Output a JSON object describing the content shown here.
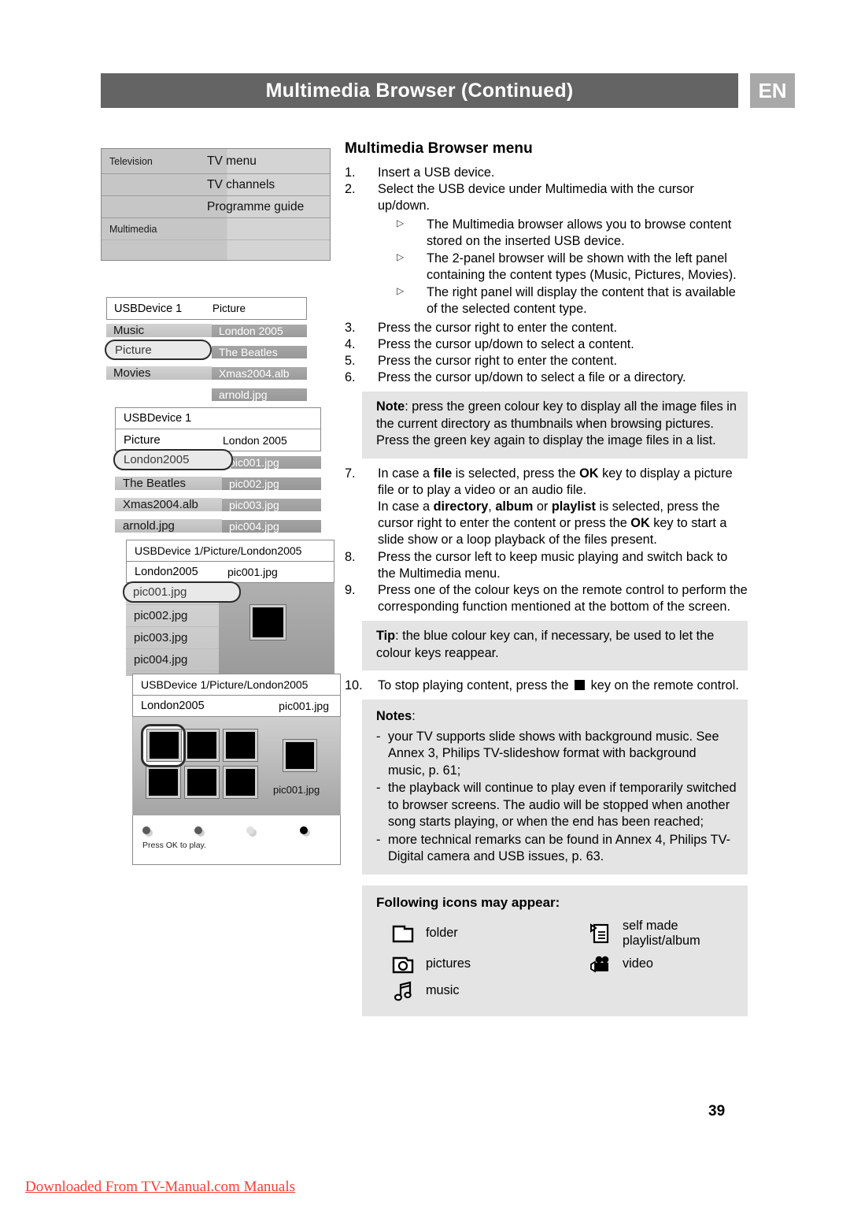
{
  "header": {
    "title": "Multimedia Browser  (Continued)",
    "language_badge": "EN",
    "bar_color": "#646464",
    "badge_color": "#a8a8a8"
  },
  "illustrations": {
    "tv_menu_panel": {
      "left_items": [
        "Television",
        "Multimedia"
      ],
      "right_items": [
        "TV menu",
        "TV channels",
        "Programme guide"
      ]
    },
    "usb_browser_panel": {
      "header_left": "USBDevice 1",
      "header_right": "Picture",
      "left_items": [
        "Music",
        "Picture",
        "Movies"
      ],
      "right_items": [
        "London 2005",
        "The Beatles",
        "Xmas2004.alb",
        "arnold.jpg"
      ],
      "selected": "Picture"
    },
    "usb_picture_panel": {
      "title": "USBDevice 1",
      "col_header_left": "Picture",
      "col_header_right": "London 2005",
      "left_items": [
        "London2005",
        "The Beatles",
        "Xmas2004.alb",
        "arnold.jpg"
      ],
      "right_items": [
        "pic001.jpg",
        "pic002.jpg",
        "pic003.jpg",
        "pic004.jpg"
      ],
      "selected": "London2005"
    },
    "usb_list_panel": {
      "path": "USBDevice 1/Picture/London2005",
      "col_header_left": "London2005",
      "col_header_right": "pic001.jpg",
      "items": [
        "pic001.jpg",
        "pic002.jpg",
        "pic003.jpg",
        "pic004.jpg"
      ],
      "selected": "pic001.jpg"
    },
    "usb_thumbnail_panel": {
      "path": "USBDevice 1/Picture/London2005",
      "col_header_left": "London2005",
      "col_header_right": "pic001.jpg",
      "preview_caption": "pic001.jpg",
      "thumbnail_count": 6,
      "status_text": "Press OK to play.",
      "colour_keys": [
        "#5a5a5a",
        "#5a5a5a",
        "#e0e0e0",
        "#000000"
      ]
    }
  },
  "main": {
    "section_title": "Multimedia Browser menu",
    "steps": [
      {
        "num": "1.",
        "text": "Insert a USB device.",
        "subs": []
      },
      {
        "num": "2.",
        "text": "Select the USB device under Multimedia with the cursor up/down.",
        "subs": [
          "The Multimedia browser allows you to browse content stored on the inserted USB device.",
          "The 2-panel browser will be shown with the left panel containing the content types (Music, Pictures, Movies).",
          "The right panel will display the content that is available of the selected content type."
        ]
      },
      {
        "num": "3.",
        "text": "Press the cursor right to enter the content.",
        "subs": []
      },
      {
        "num": "4.",
        "text": "Press the cursor up/down to select a content.",
        "subs": []
      },
      {
        "num": "5.",
        "text": "Press the cursor right to enter the content.",
        "subs": []
      },
      {
        "num": "6.",
        "text": "Press the cursor up/down to select a file or a directory.",
        "subs": []
      }
    ],
    "note_callout": {
      "label": "Note",
      "text": ": press the green colour key to display all the image files in the current directory as thumbnails when browsing pictures. Press the green key again to display the image files in a list."
    },
    "step7": {
      "num": "7.",
      "line1_a": "In case a ",
      "line1_b": "file",
      "line1_c": " is selected, press the ",
      "line1_d": "OK",
      "line1_e": " key to display a picture file or to play a video or an audio file.",
      "line2_a": "In case a ",
      "line2_b": "directory",
      "line2_c": ", ",
      "line2_d": "album",
      "line2_e": " or ",
      "line2_f": "playlist",
      "line2_g": " is selected, press the cursor right to enter the content or press the ",
      "line2_h": "OK",
      "line2_i": " key to start a slide show or a loop playback of the files present."
    },
    "step8": {
      "num": "8.",
      "text": "Press the cursor left to keep music playing and switch back to the Multimedia menu."
    },
    "step9": {
      "num": "9.",
      "text": "Press one of the colour keys on the remote control to perform the corresponding function mentioned at the bottom of the screen."
    },
    "tip_callout": {
      "label": "Tip",
      "text": ": the blue colour key can, if necessary, be used to let the colour keys reappear."
    },
    "step10": {
      "num": "10.",
      "text_before": "To stop playing content, press the ",
      "text_after": " key on the remote control."
    },
    "notes_callout": {
      "label": "Notes",
      "colon": ":",
      "items": [
        "your TV supports slide shows with background music. See Annex 3, Philips TV-slideshow format with background music, p. 61;",
        "the playback will continue to play even if temporarily switched to browser screens. The audio will be stopped when another song starts playing, or when the end has been reached;",
        "more technical remarks can be found in Annex 4, Philips TV-Digital camera and USB issues, p. 63."
      ]
    },
    "icons_box": {
      "title": "Following icons may appear:",
      "items": [
        {
          "icon": "folder-icon",
          "label": "folder"
        },
        {
          "icon": "playlist-icon",
          "label": "self made playlist/album"
        },
        {
          "icon": "camera-icon",
          "label": "pictures"
        },
        {
          "icon": "video-icon",
          "label": "video"
        },
        {
          "icon": "music-icon",
          "label": "music"
        }
      ]
    }
  },
  "footer": {
    "page_number": "39",
    "download_note": "Downloaded From TV-Manual.com Manuals"
  }
}
